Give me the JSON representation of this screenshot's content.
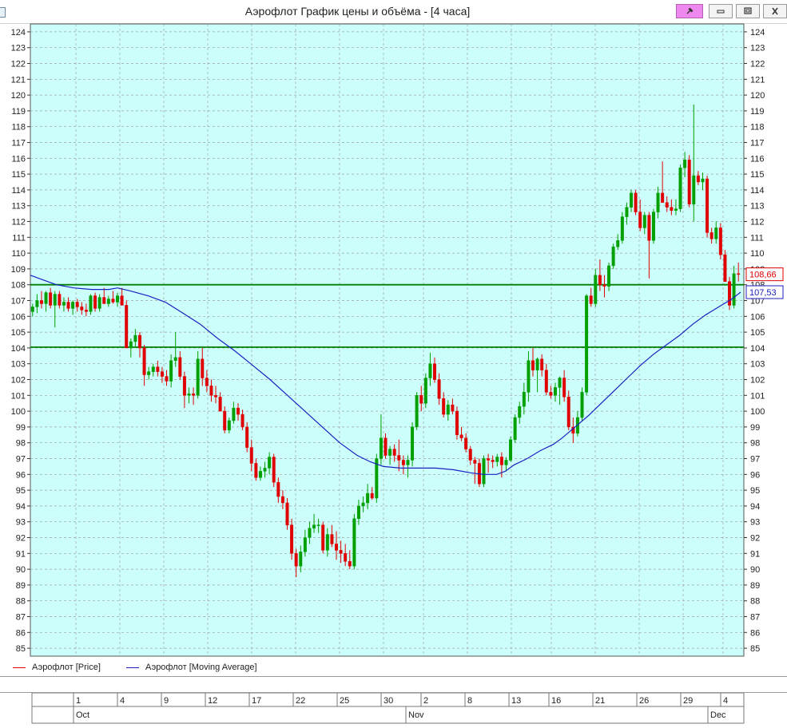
{
  "window": {
    "title": "Аэрофлот График цены и объёма - [4 часа]"
  },
  "icons": {
    "pin": "pin-icon",
    "minimize": "minimize-icon",
    "maximize": "maximize-icon",
    "close": "close-icon"
  },
  "colors": {
    "plot_bg": "#ccfffc",
    "grid": "#a0a0a0",
    "up": "#00a000",
    "down": "#e00000",
    "ma": "#1a20c0",
    "hline": "#008000"
  },
  "chart_data": {
    "type": "candlestick",
    "ylim": [
      84.5,
      124.5
    ],
    "y_ticks": [
      85,
      86,
      87,
      88,
      89,
      90,
      91,
      92,
      93,
      94,
      95,
      96,
      97,
      98,
      99,
      100,
      101,
      102,
      103,
      104,
      105,
      106,
      107,
      108,
      109,
      110,
      111,
      112,
      113,
      114,
      115,
      116,
      117,
      118,
      119,
      120,
      121,
      122,
      123,
      124
    ],
    "grid": true,
    "legend_placement": "bottom-left",
    "series": [
      {
        "name": "Аэрофлот [Price]",
        "kind": "candles",
        "color": "#e00000"
      },
      {
        "name": "Аэрофлот [Moving Average]",
        "kind": "line",
        "color": "#1a20c0"
      }
    ],
    "horizontal_lines": [
      108.0,
      104.05
    ],
    "last_price": {
      "label": "108,66",
      "value": 108.66
    },
    "last_ma": {
      "label": "107,53",
      "value": 107.53
    },
    "x_days": [
      "1",
      "4",
      "9",
      "12",
      "17",
      "22",
      "25",
      "30",
      "2",
      "8",
      "13",
      "16",
      "21",
      "26",
      "29",
      "4"
    ],
    "x_months": [
      "Oct",
      "Nov",
      "Dec"
    ],
    "candles": [
      [
        106.3,
        106.8,
        106.0,
        106.6
      ],
      [
        106.6,
        107.4,
        106.2,
        107.0
      ],
      [
        107.0,
        107.6,
        106.5,
        106.8
      ],
      [
        106.8,
        107.6,
        106.3,
        107.5
      ],
      [
        107.5,
        107.8,
        106.5,
        106.7
      ],
      [
        106.7,
        107.6,
        105.3,
        107.4
      ],
      [
        107.4,
        107.6,
        106.5,
        106.7
      ],
      [
        106.7,
        107.2,
        106.3,
        106.9
      ],
      [
        106.9,
        107.2,
        106.3,
        106.5
      ],
      [
        106.5,
        107.0,
        106.1,
        106.9
      ],
      [
        106.9,
        107.1,
        106.3,
        106.6
      ],
      [
        106.6,
        106.9,
        106.1,
        106.4
      ],
      [
        106.4,
        106.8,
        106.0,
        106.3
      ],
      [
        106.3,
        107.4,
        106.1,
        107.3
      ],
      [
        107.3,
        107.5,
        106.3,
        106.5
      ],
      [
        106.5,
        107.4,
        106.3,
        107.2
      ],
      [
        107.2,
        107.8,
        106.8,
        106.8
      ],
      [
        106.8,
        107.3,
        106.6,
        107.1
      ],
      [
        107.1,
        107.6,
        106.8,
        106.9
      ],
      [
        106.9,
        107.5,
        106.6,
        107.3
      ],
      [
        107.3,
        107.8,
        106.8,
        106.7
      ],
      [
        106.7,
        107.0,
        105.0,
        104.0
      ],
      [
        104.0,
        104.6,
        103.4,
        104.4
      ],
      [
        104.4,
        105.2,
        104.0,
        104.8
      ],
      [
        104.8,
        105.0,
        103.4,
        104.0
      ],
      [
        104.0,
        104.2,
        101.6,
        102.3
      ],
      [
        102.3,
        102.8,
        102.0,
        102.5
      ],
      [
        102.5,
        103.0,
        102.2,
        102.8
      ],
      [
        102.8,
        103.2,
        102.2,
        102.5
      ],
      [
        102.5,
        102.8,
        101.8,
        102.2
      ],
      [
        102.2,
        102.6,
        101.6,
        101.9
      ],
      [
        101.9,
        103.6,
        101.5,
        103.2
      ],
      [
        103.2,
        105.0,
        102.8,
        103.4
      ],
      [
        103.4,
        103.8,
        102.0,
        102.2
      ],
      [
        102.2,
        102.5,
        100.2,
        101.0
      ],
      [
        101.0,
        101.5,
        100.5,
        101.1
      ],
      [
        101.1,
        101.5,
        100.4,
        101.0
      ],
      [
        101.0,
        103.8,
        100.8,
        103.3
      ],
      [
        103.3,
        104.0,
        101.6,
        102.1
      ],
      [
        102.1,
        102.6,
        101.2,
        101.6
      ],
      [
        101.6,
        102.0,
        100.6,
        101.0
      ],
      [
        101.0,
        101.6,
        100.5,
        100.9
      ],
      [
        100.9,
        101.2,
        100.2,
        100.0
      ],
      [
        100.0,
        100.3,
        98.6,
        98.8
      ],
      [
        98.8,
        99.6,
        98.6,
        99.4
      ],
      [
        99.4,
        100.6,
        99.2,
        100.2
      ],
      [
        100.2,
        100.5,
        99.4,
        99.8
      ],
      [
        99.8,
        100.1,
        98.8,
        99.0
      ],
      [
        99.0,
        99.3,
        97.4,
        97.7
      ],
      [
        97.7,
        98.2,
        96.2,
        96.7
      ],
      [
        96.7,
        97.0,
        95.6,
        95.8
      ],
      [
        95.8,
        96.5,
        95.6,
        96.2
      ],
      [
        96.2,
        96.8,
        95.8,
        96.4
      ],
      [
        96.4,
        97.4,
        96.0,
        97.1
      ],
      [
        97.1,
        97.3,
        95.2,
        95.5
      ],
      [
        95.5,
        95.8,
        94.2,
        94.6
      ],
      [
        94.6,
        95.0,
        93.8,
        94.2
      ],
      [
        94.2,
        94.5,
        92.5,
        92.8
      ],
      [
        92.8,
        93.2,
        90.6,
        91.0
      ],
      [
        91.0,
        91.3,
        89.5,
        90.2
      ],
      [
        90.2,
        91.5,
        89.8,
        91.1
      ],
      [
        91.1,
        92.5,
        90.8,
        92.0
      ],
      [
        92.0,
        93.0,
        91.6,
        92.6
      ],
      [
        92.6,
        93.5,
        92.3,
        92.8
      ],
      [
        92.8,
        93.2,
        92.3,
        92.8
      ],
      [
        92.8,
        93.0,
        91.0,
        91.2
      ],
      [
        91.2,
        92.6,
        90.8,
        92.2
      ],
      [
        92.2,
        92.8,
        91.4,
        91.6
      ],
      [
        91.6,
        92.4,
        90.6,
        91.2
      ],
      [
        91.2,
        91.8,
        90.4,
        91.0
      ],
      [
        91.0,
        91.6,
        90.2,
        90.5
      ],
      [
        90.5,
        91.2,
        90.0,
        90.2
      ],
      [
        90.2,
        93.5,
        90.0,
        93.2
      ],
      [
        93.2,
        94.4,
        92.8,
        94.0
      ],
      [
        94.0,
        94.6,
        93.6,
        94.2
      ],
      [
        94.2,
        95.4,
        93.8,
        94.8
      ],
      [
        94.8,
        95.2,
        94.4,
        94.5
      ],
      [
        94.5,
        97.3,
        94.2,
        97.0
      ],
      [
        97.0,
        99.8,
        96.6,
        98.3
      ],
      [
        98.3,
        98.6,
        97.0,
        97.2
      ],
      [
        97.2,
        97.8,
        96.6,
        97.6
      ],
      [
        97.6,
        97.9,
        96.8,
        97.2
      ],
      [
        97.2,
        98.2,
        96.2,
        96.9
      ],
      [
        96.9,
        97.2,
        96.0,
        96.6
      ],
      [
        96.6,
        97.2,
        95.8,
        96.9
      ],
      [
        96.9,
        99.3,
        96.5,
        99.0
      ],
      [
        99.0,
        101.2,
        98.8,
        101.0
      ],
      [
        101.0,
        101.6,
        100.0,
        100.5
      ],
      [
        100.5,
        102.4,
        100.2,
        102.1
      ],
      [
        102.1,
        103.7,
        101.6,
        103.0
      ],
      [
        103.0,
        103.4,
        101.8,
        102.0
      ],
      [
        102.0,
        102.4,
        100.4,
        100.8
      ],
      [
        100.8,
        101.2,
        99.6,
        99.8
      ],
      [
        99.8,
        100.7,
        99.4,
        100.4
      ],
      [
        100.4,
        100.8,
        99.8,
        100.0
      ],
      [
        100.0,
        100.3,
        98.2,
        98.5
      ],
      [
        98.5,
        99.0,
        98.1,
        98.3
      ],
      [
        98.3,
        98.6,
        97.4,
        97.6
      ],
      [
        97.6,
        97.8,
        96.6,
        96.9
      ],
      [
        96.9,
        97.1,
        95.4,
        96.7
      ],
      [
        96.7,
        97.0,
        95.2,
        95.4
      ],
      [
        95.4,
        97.2,
        95.2,
        97.0
      ],
      [
        97.0,
        97.3,
        96.1,
        96.9
      ],
      [
        96.9,
        97.2,
        96.4,
        96.8
      ],
      [
        96.8,
        97.3,
        96.5,
        97.1
      ],
      [
        97.1,
        97.4,
        95.8,
        96.6
      ],
      [
        96.6,
        97.1,
        96.2,
        96.9
      ],
      [
        96.9,
        98.4,
        96.8,
        98.2
      ],
      [
        98.2,
        99.8,
        98.0,
        99.6
      ],
      [
        99.6,
        100.6,
        99.2,
        100.3
      ],
      [
        100.3,
        101.8,
        99.8,
        101.2
      ],
      [
        101.2,
        103.8,
        100.6,
        103.2
      ],
      [
        103.2,
        104.0,
        102.2,
        102.6
      ],
      [
        102.6,
        103.4,
        101.2,
        103.3
      ],
      [
        103.3,
        103.6,
        102.2,
        102.6
      ],
      [
        102.6,
        103.0,
        101.0,
        101.2
      ],
      [
        101.2,
        101.6,
        100.8,
        101.0
      ],
      [
        101.0,
        101.8,
        100.6,
        101.5
      ],
      [
        101.5,
        102.2,
        100.4,
        102.1
      ],
      [
        102.1,
        102.6,
        100.6,
        100.9
      ],
      [
        100.9,
        101.3,
        98.8,
        99.0
      ],
      [
        99.0,
        99.6,
        98.0,
        98.6
      ],
      [
        98.6,
        100.0,
        98.4,
        99.6
      ],
      [
        99.6,
        101.5,
        99.4,
        101.2
      ],
      [
        101.2,
        107.4,
        101.0,
        107.3
      ],
      [
        107.3,
        107.8,
        106.6,
        106.8
      ],
      [
        106.8,
        109.0,
        106.6,
        108.6
      ],
      [
        108.6,
        109.6,
        107.6,
        108.0
      ],
      [
        108.0,
        108.6,
        107.2,
        107.9
      ],
      [
        107.9,
        109.4,
        107.6,
        109.2
      ],
      [
        109.2,
        110.6,
        109.0,
        110.4
      ],
      [
        110.4,
        111.2,
        110.2,
        110.8
      ],
      [
        110.8,
        112.6,
        110.6,
        112.3
      ],
      [
        112.3,
        113.2,
        111.8,
        112.9
      ],
      [
        112.9,
        114.0,
        112.6,
        113.8
      ],
      [
        113.8,
        114.0,
        112.4,
        112.6
      ],
      [
        112.6,
        113.4,
        111.4,
        111.6
      ],
      [
        111.6,
        112.6,
        111.2,
        112.4
      ],
      [
        112.4,
        112.6,
        108.4,
        110.8
      ],
      [
        110.8,
        112.8,
        110.6,
        112.6
      ],
      [
        112.6,
        114.2,
        112.2,
        113.8
      ],
      [
        113.8,
        115.8,
        113.2,
        113.2
      ],
      [
        113.2,
        113.6,
        112.6,
        112.9
      ],
      [
        112.9,
        113.4,
        112.4,
        112.7
      ],
      [
        112.7,
        113.4,
        112.4,
        112.8
      ],
      [
        112.8,
        115.6,
        112.6,
        115.4
      ],
      [
        115.4,
        116.4,
        114.8,
        115.9
      ],
      [
        115.9,
        116.2,
        112.9,
        113.1
      ],
      [
        113.1,
        119.4,
        112.0,
        114.9
      ],
      [
        114.9,
        115.2,
        114.3,
        114.5
      ],
      [
        114.5,
        115.1,
        114.0,
        114.7
      ],
      [
        114.7,
        114.9,
        111.0,
        111.3
      ],
      [
        111.3,
        111.6,
        110.6,
        110.9
      ],
      [
        110.9,
        112.0,
        110.6,
        111.6
      ],
      [
        111.6,
        111.9,
        109.6,
        109.9
      ],
      [
        109.9,
        110.2,
        108.6,
        108.2
      ],
      [
        108.2,
        108.5,
        106.4,
        106.7
      ],
      [
        106.7,
        109.2,
        106.5,
        108.7
      ],
      [
        108.7,
        109.4,
        108.2,
        108.66
      ]
    ],
    "moving_average": [
      [
        0,
        108.6
      ],
      [
        3,
        108.3
      ],
      [
        6,
        108.0
      ],
      [
        10,
        107.8
      ],
      [
        14,
        107.7
      ],
      [
        18,
        107.7
      ],
      [
        20,
        107.8
      ],
      [
        23,
        107.6
      ],
      [
        27,
        107.3
      ],
      [
        31,
        106.9
      ],
      [
        35,
        106.2
      ],
      [
        39,
        105.5
      ],
      [
        43,
        104.6
      ],
      [
        47,
        103.8
      ],
      [
        51,
        102.9
      ],
      [
        55,
        102.0
      ],
      [
        59,
        101.0
      ],
      [
        63,
        100.0
      ],
      [
        67,
        99.0
      ],
      [
        71,
        98.0
      ],
      [
        75,
        97.2
      ],
      [
        78,
        96.8
      ],
      [
        81,
        96.5
      ],
      [
        85,
        96.4
      ],
      [
        89,
        96.4
      ],
      [
        93,
        96.4
      ],
      [
        97,
        96.3
      ],
      [
        101,
        96.1
      ],
      [
        104,
        96.0
      ],
      [
        107,
        96.0
      ],
      [
        109,
        96.2
      ],
      [
        111,
        96.6
      ],
      [
        114,
        97.0
      ],
      [
        117,
        97.5
      ],
      [
        120,
        97.9
      ],
      [
        122,
        98.3
      ],
      [
        125,
        99.0
      ],
      [
        128,
        99.7
      ],
      [
        131,
        100.5
      ],
      [
        134,
        101.3
      ],
      [
        137,
        102.1
      ],
      [
        140,
        102.9
      ],
      [
        143,
        103.6
      ],
      [
        146,
        104.2
      ],
      [
        149,
        104.8
      ],
      [
        152,
        105.5
      ],
      [
        155,
        106.1
      ],
      [
        158,
        106.6
      ],
      [
        161,
        107.1
      ],
      [
        163,
        107.53
      ]
    ]
  },
  "legend": {
    "price": "Аэрофлот [Price]",
    "ma": "Аэрофлот [Moving Average]"
  }
}
